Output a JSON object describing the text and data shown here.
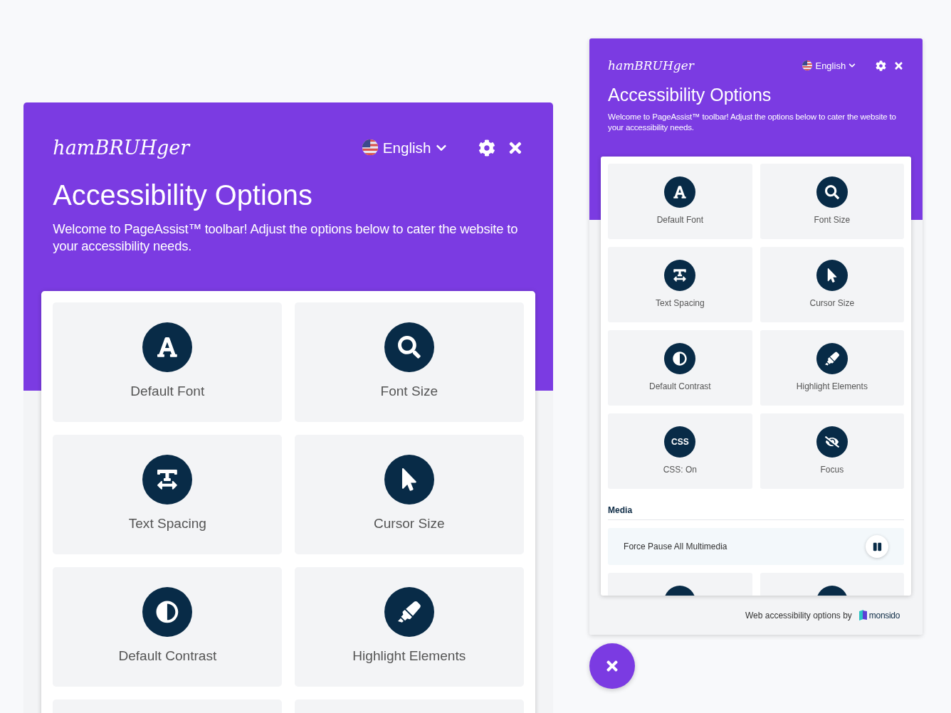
{
  "panels": [
    {
      "logo": "hamBRUHger",
      "language": "English",
      "title": "Accessibility Options",
      "description": "Welcome to PageAssist™ toolbar! Adjust the options below to cater the website to your accessibility needs.",
      "tiles": [
        {
          "kind": "icon",
          "label": "Default Font"
        },
        {
          "kind": "icon",
          "label": "Font Size"
        },
        {
          "kind": "icon",
          "label": "Text Spacing"
        },
        {
          "kind": "icon",
          "label": "Cursor Size"
        },
        {
          "kind": "icon",
          "label": "Default Contrast"
        },
        {
          "kind": "icon",
          "label": "Highlight Elements"
        },
        {
          "kind": "stub"
        },
        {
          "kind": "stub"
        }
      ]
    },
    {
      "logo": "hamBRUHger",
      "language": "English",
      "title": "Accessibility Options",
      "description": "Welcome to PageAssist™ toolbar! Adjust the options below to cater the website to your accessibility needs.",
      "tiles": [
        {
          "kind": "icon",
          "label": "Default Font"
        },
        {
          "kind": "icon",
          "label": "Font Size"
        },
        {
          "kind": "icon",
          "label": "Text Spacing"
        },
        {
          "kind": "icon",
          "label": "Cursor Size"
        },
        {
          "kind": "icon",
          "label": "Default Contrast"
        },
        {
          "kind": "icon",
          "label": "Highlight Elements"
        },
        {
          "kind": "badge",
          "badge": "CSS",
          "label": "CSS: On"
        },
        {
          "kind": "icon",
          "label": "Focus"
        }
      ],
      "media": {
        "heading": "Media",
        "option": "Force Pause All Multimedia"
      },
      "more_tiles": [
        {
          "kind": "cut"
        },
        {
          "kind": "cut"
        }
      ],
      "footer": {
        "text": "Web accessibility options by",
        "brand": "monsido"
      }
    }
  ]
}
